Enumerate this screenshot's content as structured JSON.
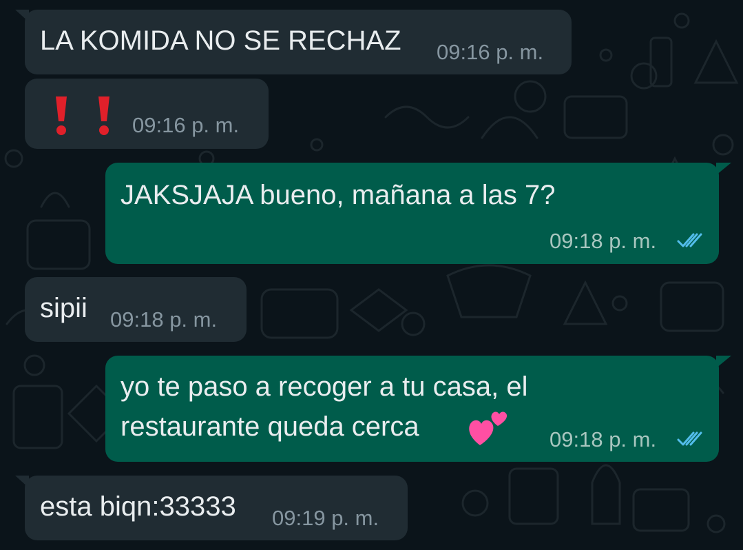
{
  "colors": {
    "background": "#0b141a",
    "incoming_bubble": "#202c33",
    "outgoing_bubble": "#005c4b",
    "text": "#e9edef",
    "timestamp": "#8696a0",
    "read_ticks": "#53bdeb",
    "exclamation": "#e0202a",
    "hearts": "#ff4fa3"
  },
  "messages": [
    {
      "direction": "incoming",
      "text": "LA KOMIDA NO SE RECHAZ",
      "time": "09:16 p. m."
    },
    {
      "direction": "incoming",
      "text": "",
      "icons": [
        "exclamation-icon",
        "exclamation-icon"
      ],
      "time": "09:16 p. m."
    },
    {
      "direction": "outgoing",
      "text": "JAKSJAJA bueno, mañana a las 7?",
      "time": "09:18 p. m.",
      "status": "read"
    },
    {
      "direction": "incoming",
      "text": "sipii",
      "time": "09:18 p. m."
    },
    {
      "direction": "outgoing",
      "lines": [
        "yo te paso a recoger a tu casa, el",
        "restaurante queda cerca"
      ],
      "icons": [
        "two-hearts-icon"
      ],
      "time": "09:18 p. m.",
      "status": "read"
    },
    {
      "direction": "incoming",
      "text": "esta biqn:33333",
      "time": "09:19 p. m."
    }
  ]
}
